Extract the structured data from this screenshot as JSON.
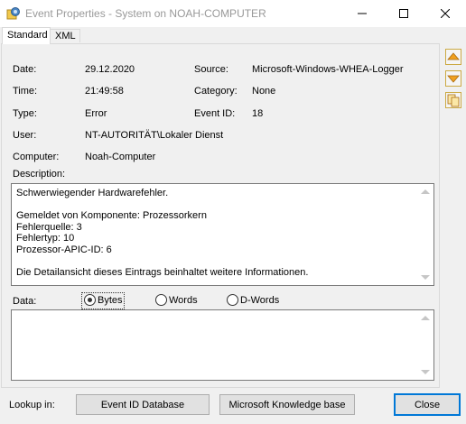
{
  "window": {
    "title": "Event Properties - System on NOAH-COMPUTER",
    "icon": "event-viewer-icon"
  },
  "tabs": [
    {
      "label": "Standard",
      "active": true
    },
    {
      "label": "XML",
      "active": false
    }
  ],
  "fields": {
    "date_label": "Date:",
    "date_value": "29.12.2020",
    "time_label": "Time:",
    "time_value": "21:49:58",
    "type_label": "Type:",
    "type_value": "Error",
    "user_label": "User:",
    "user_value": "NT-AUTORITÄT\\Lokaler Dienst",
    "computer_label": "Computer:",
    "computer_value": "Noah-Computer",
    "source_label": "Source:",
    "source_value": "Microsoft-Windows-WHEA-Logger",
    "category_label": "Category:",
    "category_value": "None",
    "eventid_label": "Event ID:",
    "eventid_value": "18"
  },
  "description": {
    "label": "Description:",
    "text": "Schwerwiegender Hardwarefehler.\n\nGemeldet von Komponente: Prozessorkern\nFehlerquelle: 3\nFehlertyp: 10\nProzessor-APIC-ID: 6\n\nDie Detailansicht dieses Eintrags beinhaltet weitere Informationen."
  },
  "data_section": {
    "label": "Data:",
    "options": [
      "Bytes",
      "Words",
      "D-Words"
    ],
    "selected": "Bytes"
  },
  "footer": {
    "lookup_label": "Lookup in:",
    "event_id_db_button": "Event ID Database",
    "kb_button": "Microsoft Knowledge base",
    "close_button": "Close"
  },
  "colors": {
    "accent": "#0078d7",
    "side_button_arrow": "#f0a020"
  }
}
